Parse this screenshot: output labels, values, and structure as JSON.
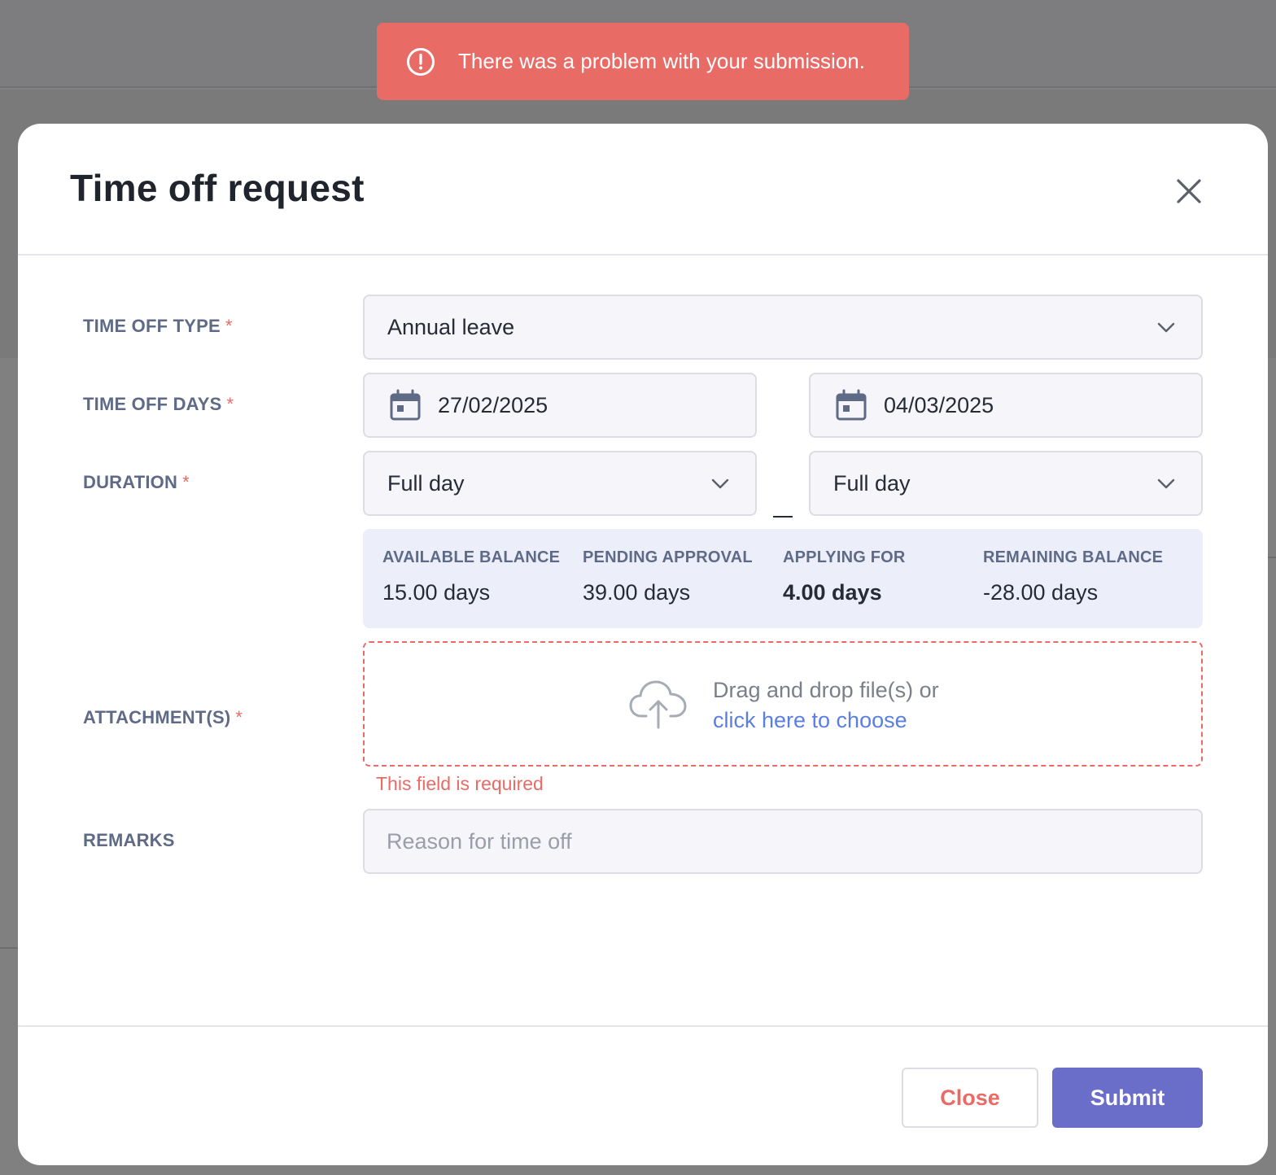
{
  "toast": {
    "message": "There was a problem with your submission.",
    "icon": "alert-circle-icon",
    "color": "#e96b66"
  },
  "modal": {
    "title": "Time off request",
    "close_icon": "close-icon"
  },
  "form": {
    "time_off_type": {
      "label": "TIME OFF TYPE",
      "required_mark": "*",
      "value": "Annual leave"
    },
    "time_off_days": {
      "label": "TIME OFF DAYS",
      "required_mark": "*",
      "start_date": "27/02/2025",
      "end_date": "04/03/2025"
    },
    "duration": {
      "label": "DURATION",
      "required_mark": "*",
      "start_value": "Full day",
      "end_value": "Full day"
    },
    "balance": [
      {
        "title": "AVAILABLE BALANCE",
        "value": "15.00 days"
      },
      {
        "title": "PENDING APPROVAL",
        "value": "39.00 days"
      },
      {
        "title": "APPLYING FOR",
        "value": "4.00 days"
      },
      {
        "title": "REMAINING BALANCE",
        "value": "-28.00 days"
      }
    ],
    "attachments": {
      "label": "ATTACHMENT(S)",
      "required_mark": "*",
      "drop_text": "Drag and drop file(s) or",
      "link_text": "click here to choose",
      "error": "This field is required"
    },
    "remarks": {
      "label": "REMARKS",
      "placeholder": "Reason for time off",
      "value": ""
    }
  },
  "footer": {
    "close_label": "Close",
    "submit_label": "Submit"
  },
  "colors": {
    "accent": "#6b6ec8",
    "error": "#e96b66",
    "link": "#5a7fe0"
  }
}
